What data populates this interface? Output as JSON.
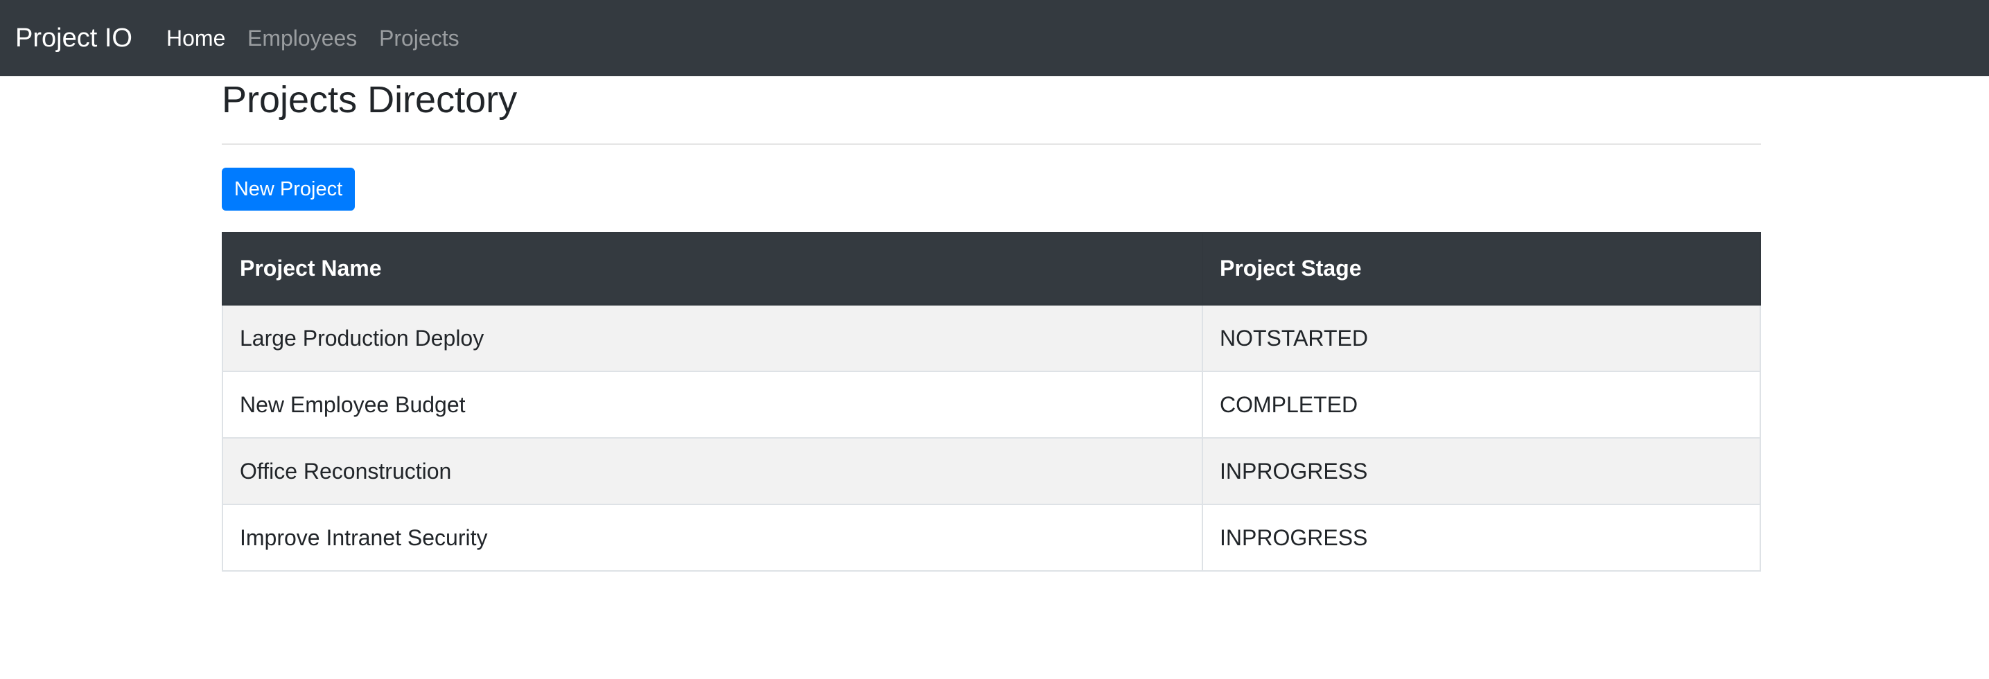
{
  "navbar": {
    "brand": "Project IO",
    "links": [
      {
        "label": "Home",
        "active": true
      },
      {
        "label": "Employees",
        "active": false
      },
      {
        "label": "Projects",
        "active": false
      }
    ],
    "background": "#343a40"
  },
  "main": {
    "title": "Projects Directory",
    "new_button_label": "New Project",
    "button_color": "#007bff",
    "table": {
      "columns": [
        "Project Name",
        "Project Stage"
      ],
      "rows": [
        {
          "name": "Large Production Deploy",
          "stage": "NOTSTARTED"
        },
        {
          "name": "New Employee Budget",
          "stage": "COMPLETED"
        },
        {
          "name": "Office Reconstruction",
          "stage": "INPROGRESS"
        },
        {
          "name": "Improve Intranet Security",
          "stage": "INPROGRESS"
        }
      ]
    }
  }
}
